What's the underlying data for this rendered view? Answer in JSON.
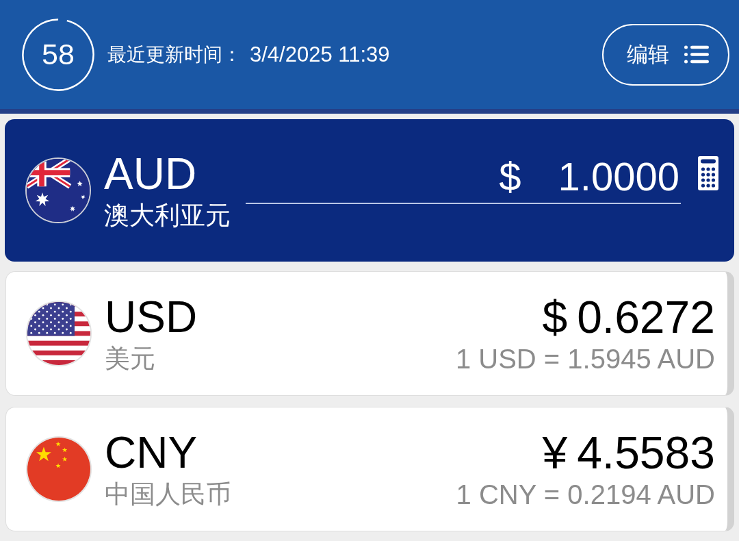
{
  "header": {
    "countdown": {
      "value": "58",
      "level": 0.96
    },
    "updated_label": "最近更新时间：",
    "updated_time": "3/4/2025 11:39",
    "edit_button": {
      "label": "编辑"
    }
  },
  "base_currency": {
    "kind": "au",
    "code": "AUD",
    "name": "澳大利亚元",
    "symbol": "$",
    "amount": "1.0000"
  },
  "currencies": [
    {
      "kind": "us",
      "code": "USD",
      "name": "美元",
      "symbol": "$",
      "amount": "0.6272",
      "rate": "1 USD = 1.5945 AUD"
    },
    {
      "kind": "cn",
      "code": "CNY",
      "name": "中国人民币",
      "symbol": "¥",
      "amount": "4.5583",
      "rate": "1 CNY = 0.2194 AUD"
    }
  ]
}
